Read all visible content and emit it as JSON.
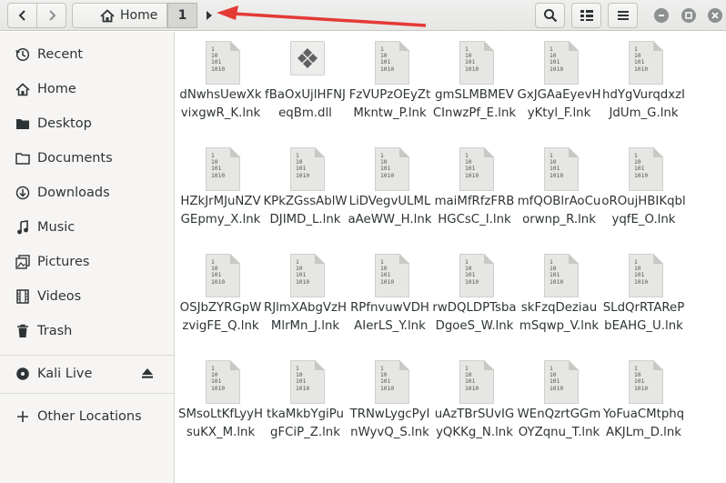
{
  "header": {
    "breadcrumb": {
      "home_label": "Home",
      "current_label": "1"
    }
  },
  "sidebar": {
    "items": [
      {
        "label": "Recent",
        "icon": "clock-icon"
      },
      {
        "label": "Home",
        "icon": "home-icon"
      },
      {
        "label": "Desktop",
        "icon": "folder-icon"
      },
      {
        "label": "Documents",
        "icon": "document-icon"
      },
      {
        "label": "Downloads",
        "icon": "download-icon"
      },
      {
        "label": "Music",
        "icon": "music-icon"
      },
      {
        "label": "Pictures",
        "icon": "image-icon"
      },
      {
        "label": "Videos",
        "icon": "video-icon"
      },
      {
        "label": "Trash",
        "icon": "trash-icon"
      }
    ],
    "devices": [
      {
        "label": "Kali Live",
        "icon": "disc-icon"
      }
    ],
    "other": {
      "label": "Other Locations",
      "icon": "plus-icon"
    }
  },
  "files": [
    {
      "name": "dNwhsUewXkvixgwR_K.lnk",
      "icon": "binary-file-icon"
    },
    {
      "name": "fBaOxUjlHFNJeqBm.dll",
      "icon": "library-icon"
    },
    {
      "name": "FzVUPzOEyZtMkntw_P.lnk",
      "icon": "binary-file-icon"
    },
    {
      "name": "gmSLMBMEVCInwzPf_E.lnk",
      "icon": "binary-file-icon"
    },
    {
      "name": "GxJGAaEyevHyKtyl_F.lnk",
      "icon": "binary-file-icon"
    },
    {
      "name": "hdYgVurqdxzIJdUm_G.lnk",
      "icon": "binary-file-icon"
    },
    {
      "name": "HZkJrMJuNZVGEpmy_X.lnk",
      "icon": "binary-file-icon"
    },
    {
      "name": "KPkZGssAblWDJIMD_L.lnk",
      "icon": "binary-file-icon"
    },
    {
      "name": "LiDVegvULMLaAeWW_H.lnk",
      "icon": "binary-file-icon"
    },
    {
      "name": "maiMfRfzFRBHGCsC_I.lnk",
      "icon": "binary-file-icon"
    },
    {
      "name": "mfQOBlrAoCuorwnp_R.lnk",
      "icon": "binary-file-icon"
    },
    {
      "name": "oROujHBIKqblyqfE_O.lnk",
      "icon": "binary-file-icon"
    },
    {
      "name": "OSJbZYRGpWzvigFE_Q.lnk",
      "icon": "binary-file-icon"
    },
    {
      "name": "RJlmXAbgVzHMlrMn_J.lnk",
      "icon": "binary-file-icon"
    },
    {
      "name": "RPfnvuwVDHAIerLS_Y.lnk",
      "icon": "binary-file-icon"
    },
    {
      "name": "rwDQLDPTsbaDgoeS_W.lnk",
      "icon": "binary-file-icon"
    },
    {
      "name": "skFzqDeziaumSqwp_V.lnk",
      "icon": "binary-file-icon"
    },
    {
      "name": "SLdQrRTARePbEAHG_U.lnk",
      "icon": "binary-file-icon"
    },
    {
      "name": "SMsoLtKfLyyHsuKX_M.lnk",
      "icon": "binary-file-icon"
    },
    {
      "name": "tkaMkbYgiPugFCiP_Z.lnk",
      "icon": "binary-file-icon"
    },
    {
      "name": "TRNwLygcPyInWyvQ_S.lnk",
      "icon": "binary-file-icon"
    },
    {
      "name": "uAzTBrSUvIGyQKKg_N.lnk",
      "icon": "binary-file-icon"
    },
    {
      "name": "WEnQzrtGGmOYZqnu_T.lnk",
      "icon": "binary-file-icon"
    },
    {
      "name": "YoFuaCMtphqAKJLm_D.lnk",
      "icon": "binary-file-icon"
    }
  ],
  "colors": {
    "annotation_arrow": "#e53935",
    "sidebar_bg": "#f6f5f4",
    "file_icon": "#e6e6e4"
  }
}
